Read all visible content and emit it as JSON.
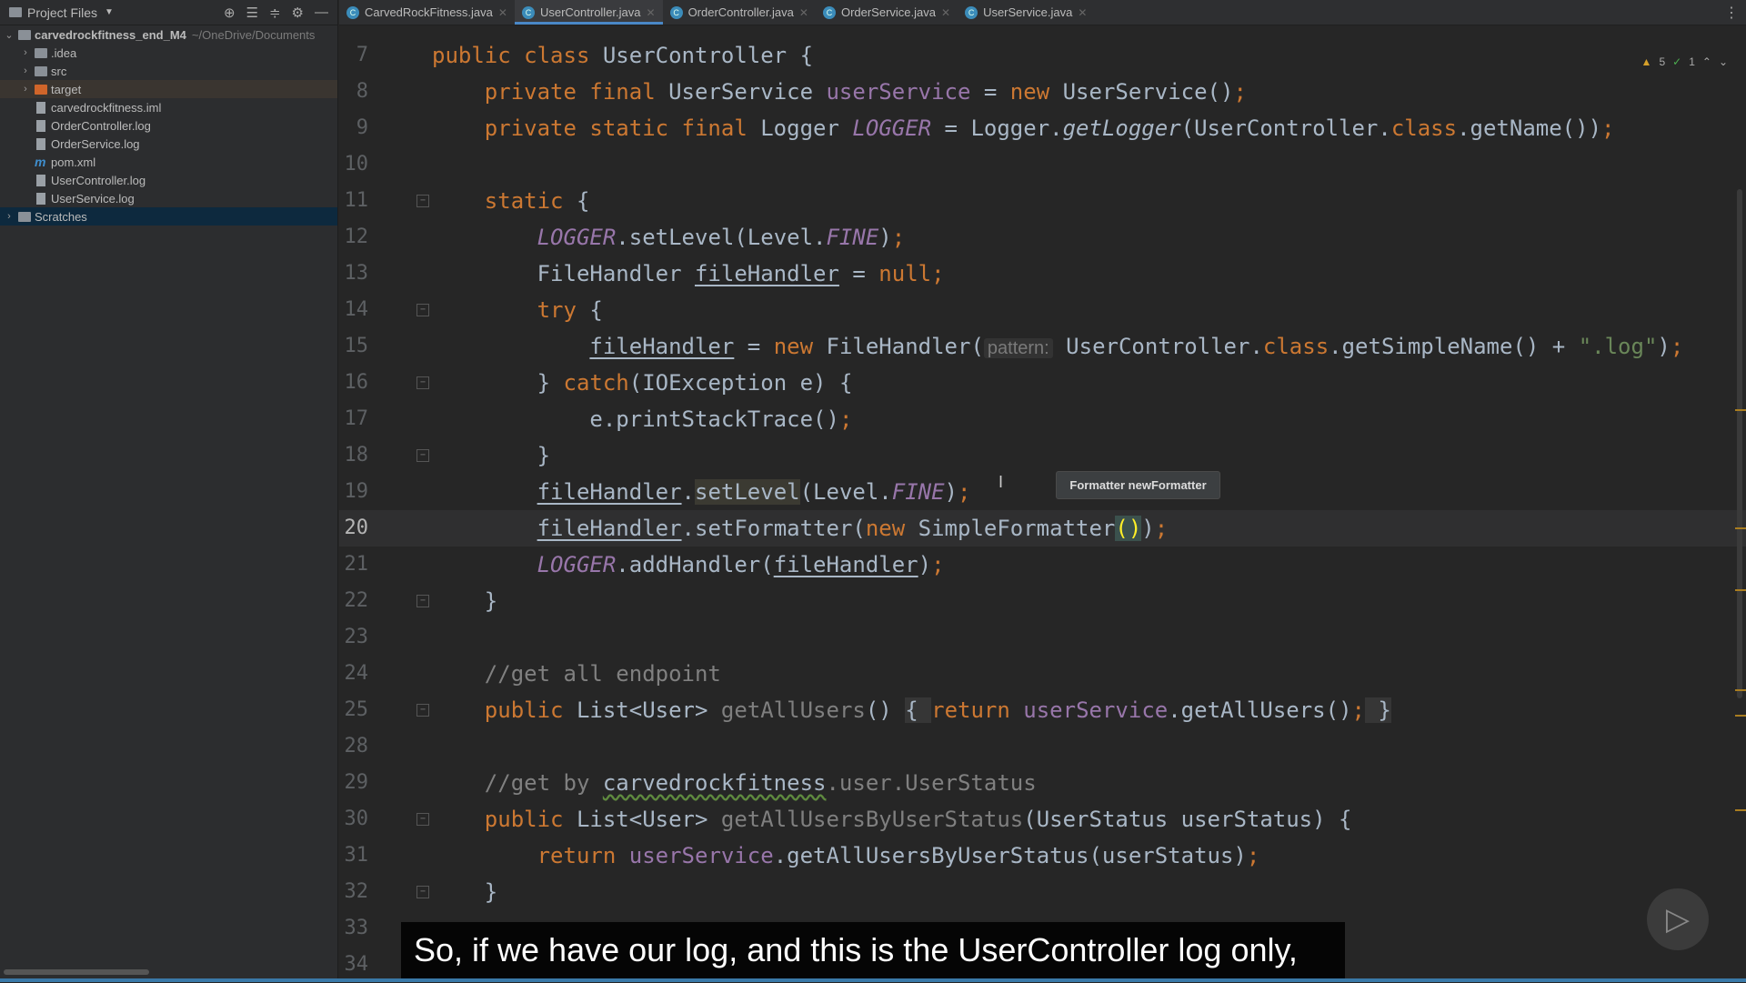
{
  "sidebar": {
    "title": "Project Files",
    "root": {
      "name": "carvedrockfitness_end_M4",
      "path": "~/OneDrive/Documents"
    },
    "items": [
      {
        "label": ".idea",
        "type": "folder",
        "chevron": true
      },
      {
        "label": "src",
        "type": "folder",
        "chevron": true
      },
      {
        "label": "target",
        "type": "folder-orange",
        "chevron": true
      },
      {
        "label": "carvedrockfitness.iml",
        "type": "file"
      },
      {
        "label": "OrderController.log",
        "type": "file"
      },
      {
        "label": "OrderService.log",
        "type": "file"
      },
      {
        "label": "pom.xml",
        "type": "maven"
      },
      {
        "label": "UserController.log",
        "type": "file"
      },
      {
        "label": "UserService.log",
        "type": "file"
      }
    ],
    "scratches": "Scratches"
  },
  "tabs": [
    {
      "label": "CarvedRockFitness.java",
      "active": false
    },
    {
      "label": "UserController.java",
      "active": true
    },
    {
      "label": "OrderController.java",
      "active": false
    },
    {
      "label": "OrderService.java",
      "active": false
    },
    {
      "label": "UserService.java",
      "active": false
    }
  ],
  "inspections": {
    "warnings": "5",
    "weak_warnings": "1"
  },
  "code": [
    {
      "n": "7",
      "t": [
        [
          "public class ",
          "k"
        ],
        [
          "UserController {",
          "t"
        ]
      ]
    },
    {
      "n": "8",
      "t": [
        [
          "    private final ",
          "k"
        ],
        [
          "UserService ",
          "t"
        ],
        [
          "userService",
          "f"
        ],
        [
          " = ",
          "t"
        ],
        [
          "new ",
          "k"
        ],
        [
          "UserService()",
          "t"
        ],
        [
          ";",
          "k"
        ]
      ]
    },
    {
      "n": "9",
      "t": [
        [
          "    private static final ",
          "k"
        ],
        [
          "Logger ",
          "t"
        ],
        [
          "LOGGER",
          "fi"
        ],
        [
          " = Logger.",
          "t"
        ],
        [
          "getLogger",
          "it"
        ],
        [
          "(UserController.",
          "t"
        ],
        [
          "class",
          "k"
        ],
        [
          ".getName())",
          "t"
        ],
        [
          ";",
          "k"
        ]
      ]
    },
    {
      "n": "10",
      "t": []
    },
    {
      "n": "11",
      "fold": true,
      "t": [
        [
          "    static ",
          "k"
        ],
        [
          "{",
          "t"
        ]
      ]
    },
    {
      "n": "12",
      "t": [
        [
          "        ",
          "t"
        ],
        [
          "LOGGER",
          "fi"
        ],
        [
          ".setLevel(Level.",
          "t"
        ],
        [
          "FINE",
          "fi"
        ],
        [
          ")",
          "t"
        ],
        [
          ";",
          "k"
        ]
      ]
    },
    {
      "n": "13",
      "t": [
        [
          "        FileHandler ",
          "t"
        ],
        [
          "fileHandler",
          "u"
        ],
        [
          " = ",
          "t"
        ],
        [
          "null;",
          "k"
        ]
      ]
    },
    {
      "n": "14",
      "fold": true,
      "t": [
        [
          "        try ",
          "k"
        ],
        [
          "{",
          "t"
        ]
      ]
    },
    {
      "n": "15",
      "t": [
        [
          "            ",
          "t"
        ],
        [
          "fileHandler",
          "u"
        ],
        [
          " = ",
          "t"
        ],
        [
          "new ",
          "k"
        ],
        [
          "FileHandler(",
          "t"
        ],
        [
          "pattern:",
          "h"
        ],
        [
          " UserController.",
          "t"
        ],
        [
          "class",
          "k"
        ],
        [
          ".getSimpleName() + ",
          "t"
        ],
        [
          "\".log\"",
          "s"
        ],
        [
          ")",
          "t"
        ],
        [
          ";",
          "k"
        ]
      ]
    },
    {
      "n": "16",
      "fold": true,
      "t": [
        [
          "        } ",
          "t"
        ],
        [
          "catch",
          "k"
        ],
        [
          "(IOException e) {",
          "t"
        ]
      ]
    },
    {
      "n": "17",
      "t": [
        [
          "            e.printStackTrace()",
          "t"
        ],
        [
          ";",
          "k"
        ]
      ]
    },
    {
      "n": "18",
      "fold": true,
      "t": [
        [
          "        }",
          "t"
        ]
      ]
    },
    {
      "n": "19",
      "t": [
        [
          "        ",
          "t"
        ],
        [
          "fileHandler",
          "u"
        ],
        [
          ".",
          "t"
        ],
        [
          "setLevel",
          "hl"
        ],
        [
          "(Level.",
          "t"
        ],
        [
          "FINE",
          "fi"
        ],
        [
          ")",
          "t"
        ],
        [
          ";",
          "k"
        ]
      ]
    },
    {
      "n": "20",
      "cur": true,
      "t": [
        [
          "        ",
          "t"
        ],
        [
          "fileHandler",
          "u"
        ],
        [
          ".setFormatter(",
          "t"
        ],
        [
          "new ",
          "k"
        ],
        [
          "SimpleFormatter",
          "t"
        ],
        [
          "()",
          "br"
        ],
        [
          ")",
          "t"
        ],
        [
          ";",
          "k"
        ]
      ]
    },
    {
      "n": "21",
      "t": [
        [
          "        ",
          "t"
        ],
        [
          "LOGGER",
          "fi"
        ],
        [
          ".addHandler(",
          "t"
        ],
        [
          "fileHandler",
          "u"
        ],
        [
          ")",
          "t"
        ],
        [
          ";",
          "k"
        ]
      ]
    },
    {
      "n": "22",
      "fold": true,
      "t": [
        [
          "    }",
          "t"
        ]
      ]
    },
    {
      "n": "23",
      "t": []
    },
    {
      "n": "24",
      "t": [
        [
          "    //get all endpoint",
          "c"
        ]
      ]
    },
    {
      "n": "25",
      "fold": true,
      "t": [
        [
          "    public ",
          "k"
        ],
        [
          "List<User> ",
          "t"
        ],
        [
          "getAllUsers",
          "m"
        ],
        [
          "() ",
          "t"
        ],
        [
          "{ ",
          "fold-bg"
        ],
        [
          "return ",
          "k"
        ],
        [
          "userService",
          "f"
        ],
        [
          ".getAllUsers()",
          "t"
        ],
        [
          ";",
          "k"
        ],
        [
          " }",
          "fold-bg"
        ]
      ]
    },
    {
      "n": "28",
      "t": []
    },
    {
      "n": "29",
      "t": [
        [
          "    //get by ",
          "c"
        ],
        [
          "carvedrockfitness",
          "wv"
        ],
        [
          ".user.UserStatus",
          "c"
        ]
      ]
    },
    {
      "n": "30",
      "fold": true,
      "t": [
        [
          "    public ",
          "k"
        ],
        [
          "List<User> ",
          "t"
        ],
        [
          "getAllUsersByUserStatus",
          "m"
        ],
        [
          "(UserStatus userStatus) {",
          "t"
        ]
      ]
    },
    {
      "n": "31",
      "t": [
        [
          "        return ",
          "k"
        ],
        [
          "userService",
          "f"
        ],
        [
          ".getAllUsersByUserStatus(userStatus)",
          "t"
        ],
        [
          ";",
          "k"
        ]
      ]
    },
    {
      "n": "32",
      "fold": true,
      "t": [
        [
          "    }",
          "t"
        ]
      ]
    },
    {
      "n": "33",
      "t": []
    },
    {
      "n": "34",
      "t": []
    }
  ],
  "tooltip": "Formatter newFormatter",
  "subtitle": "So, if we have our log, and this is the UserController log only,"
}
